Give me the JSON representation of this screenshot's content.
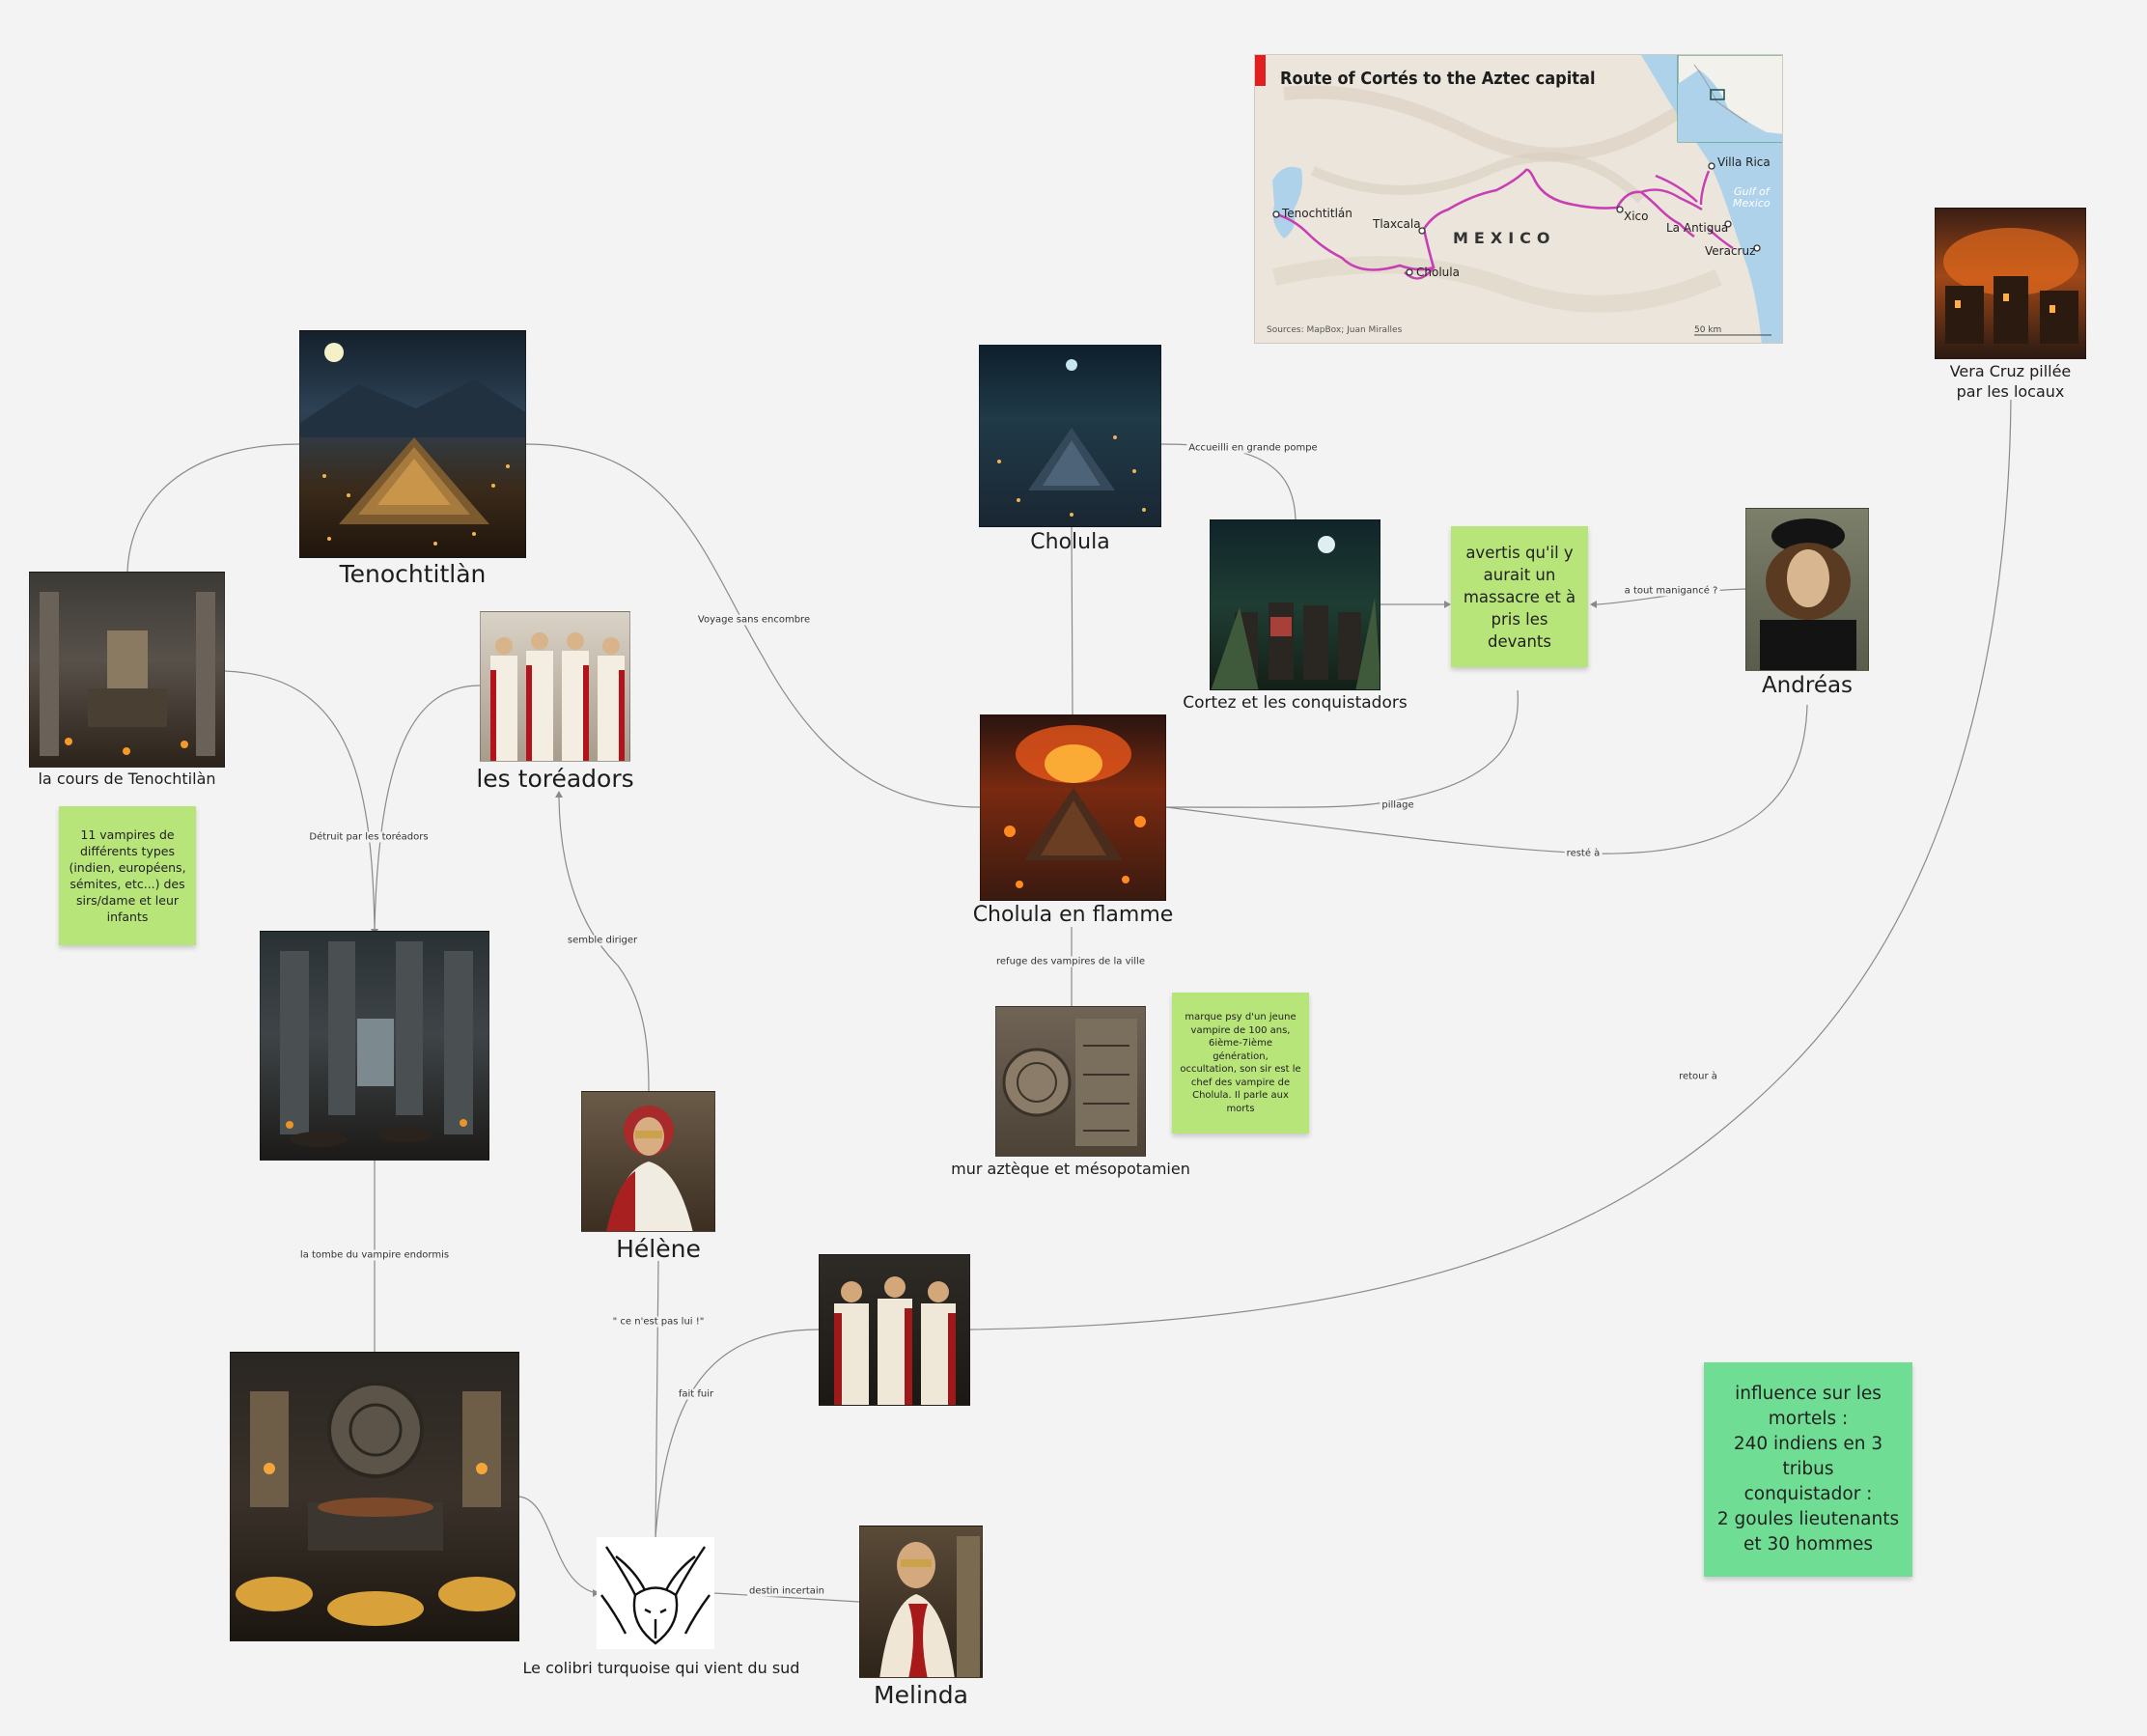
{
  "colors": {
    "background": "#f3f3f3",
    "edge": "#8a8a8a",
    "sticky_lime": "#b8e57a",
    "sticky_green": "#6fde94",
    "route": "#c73fb3",
    "sea": "#aed2ea",
    "map_accent": "#e02020"
  },
  "nodes": {
    "tenochtitlan": {
      "label": "Tenochtitlàn"
    },
    "cour": {
      "label": "la cours de Tenochtilàn"
    },
    "toreadors": {
      "label": "les toréadors"
    },
    "cholula": {
      "label": "Cholula"
    },
    "cortez": {
      "label": "Cortez et les conquistadors"
    },
    "andreas": {
      "label": "Andréas"
    },
    "cholula_flamme": {
      "label": "Cholula en flamme"
    },
    "mur": {
      "label": "mur aztèque et mésopotamien"
    },
    "vera_cruz": {
      "label": "Vera Cruz pillée\npar les locaux"
    },
    "helene": {
      "label": "Hélène"
    },
    "colibri": {
      "label": "Le colibri turquoise qui vient du sud"
    },
    "melinda": {
      "label": "Melinda"
    },
    "palace_ruins": {
      "label": ""
    },
    "tomb": {
      "label": ""
    },
    "three_women": {
      "label": ""
    }
  },
  "stickies": {
    "vampires": {
      "text": "11 vampires de\ndifférents types\n(indien, européens,\nsémites, etc...) des\nsirs/dame et leur\ninfants"
    },
    "avertis": {
      "text": "avertis qu'il y\naurait un\nmassacre et à\npris les\ndevants"
    },
    "marque": {
      "text": "marque psy d'un jeune\nvampire de 100 ans,\n6ième-7ième génération,\noccultation, son sir est le\nchef des vampire de\nCholula. Il parle aux morts"
    },
    "influence": {
      "text": "influence sur les\nmortels :\n240 indiens en 3\ntribus\nconquistador :\n2 goules lieutenants\net 30 hommes"
    }
  },
  "edge_labels": {
    "voyage": "Voyage sans encombre",
    "accueilli": "Accueilli en grande pompe",
    "manigance": "a tout manigancé ?",
    "pillage": "pillage",
    "reste": "resté à",
    "detruit": "Détruit par les toréadors",
    "semble": "semble diriger",
    "refuge": "refuge des vampires de la ville",
    "retour": "retour à",
    "tombe": "la tombe du vampire endormis",
    "pas_lui": "\" ce n'est pas lui !\"",
    "fait_fuir": "fait fuir",
    "destin": "destin incertain"
  },
  "map": {
    "title": "Route of Cortés to the Aztec capital",
    "country": "MEXICO",
    "gulf": "Gulf of\nMexico",
    "sources": "Sources: MapBox; Juan Miralles",
    "scale": "50 km",
    "cities": {
      "tenochtitlan": "Tenochtitlán",
      "tlaxcala": "Tlaxcala",
      "cholula": "Cholula",
      "xico": "Xico",
      "villa_rica": "Villa Rica",
      "la_antigua": "La Antigua",
      "veracruz": "Veracruz"
    }
  }
}
